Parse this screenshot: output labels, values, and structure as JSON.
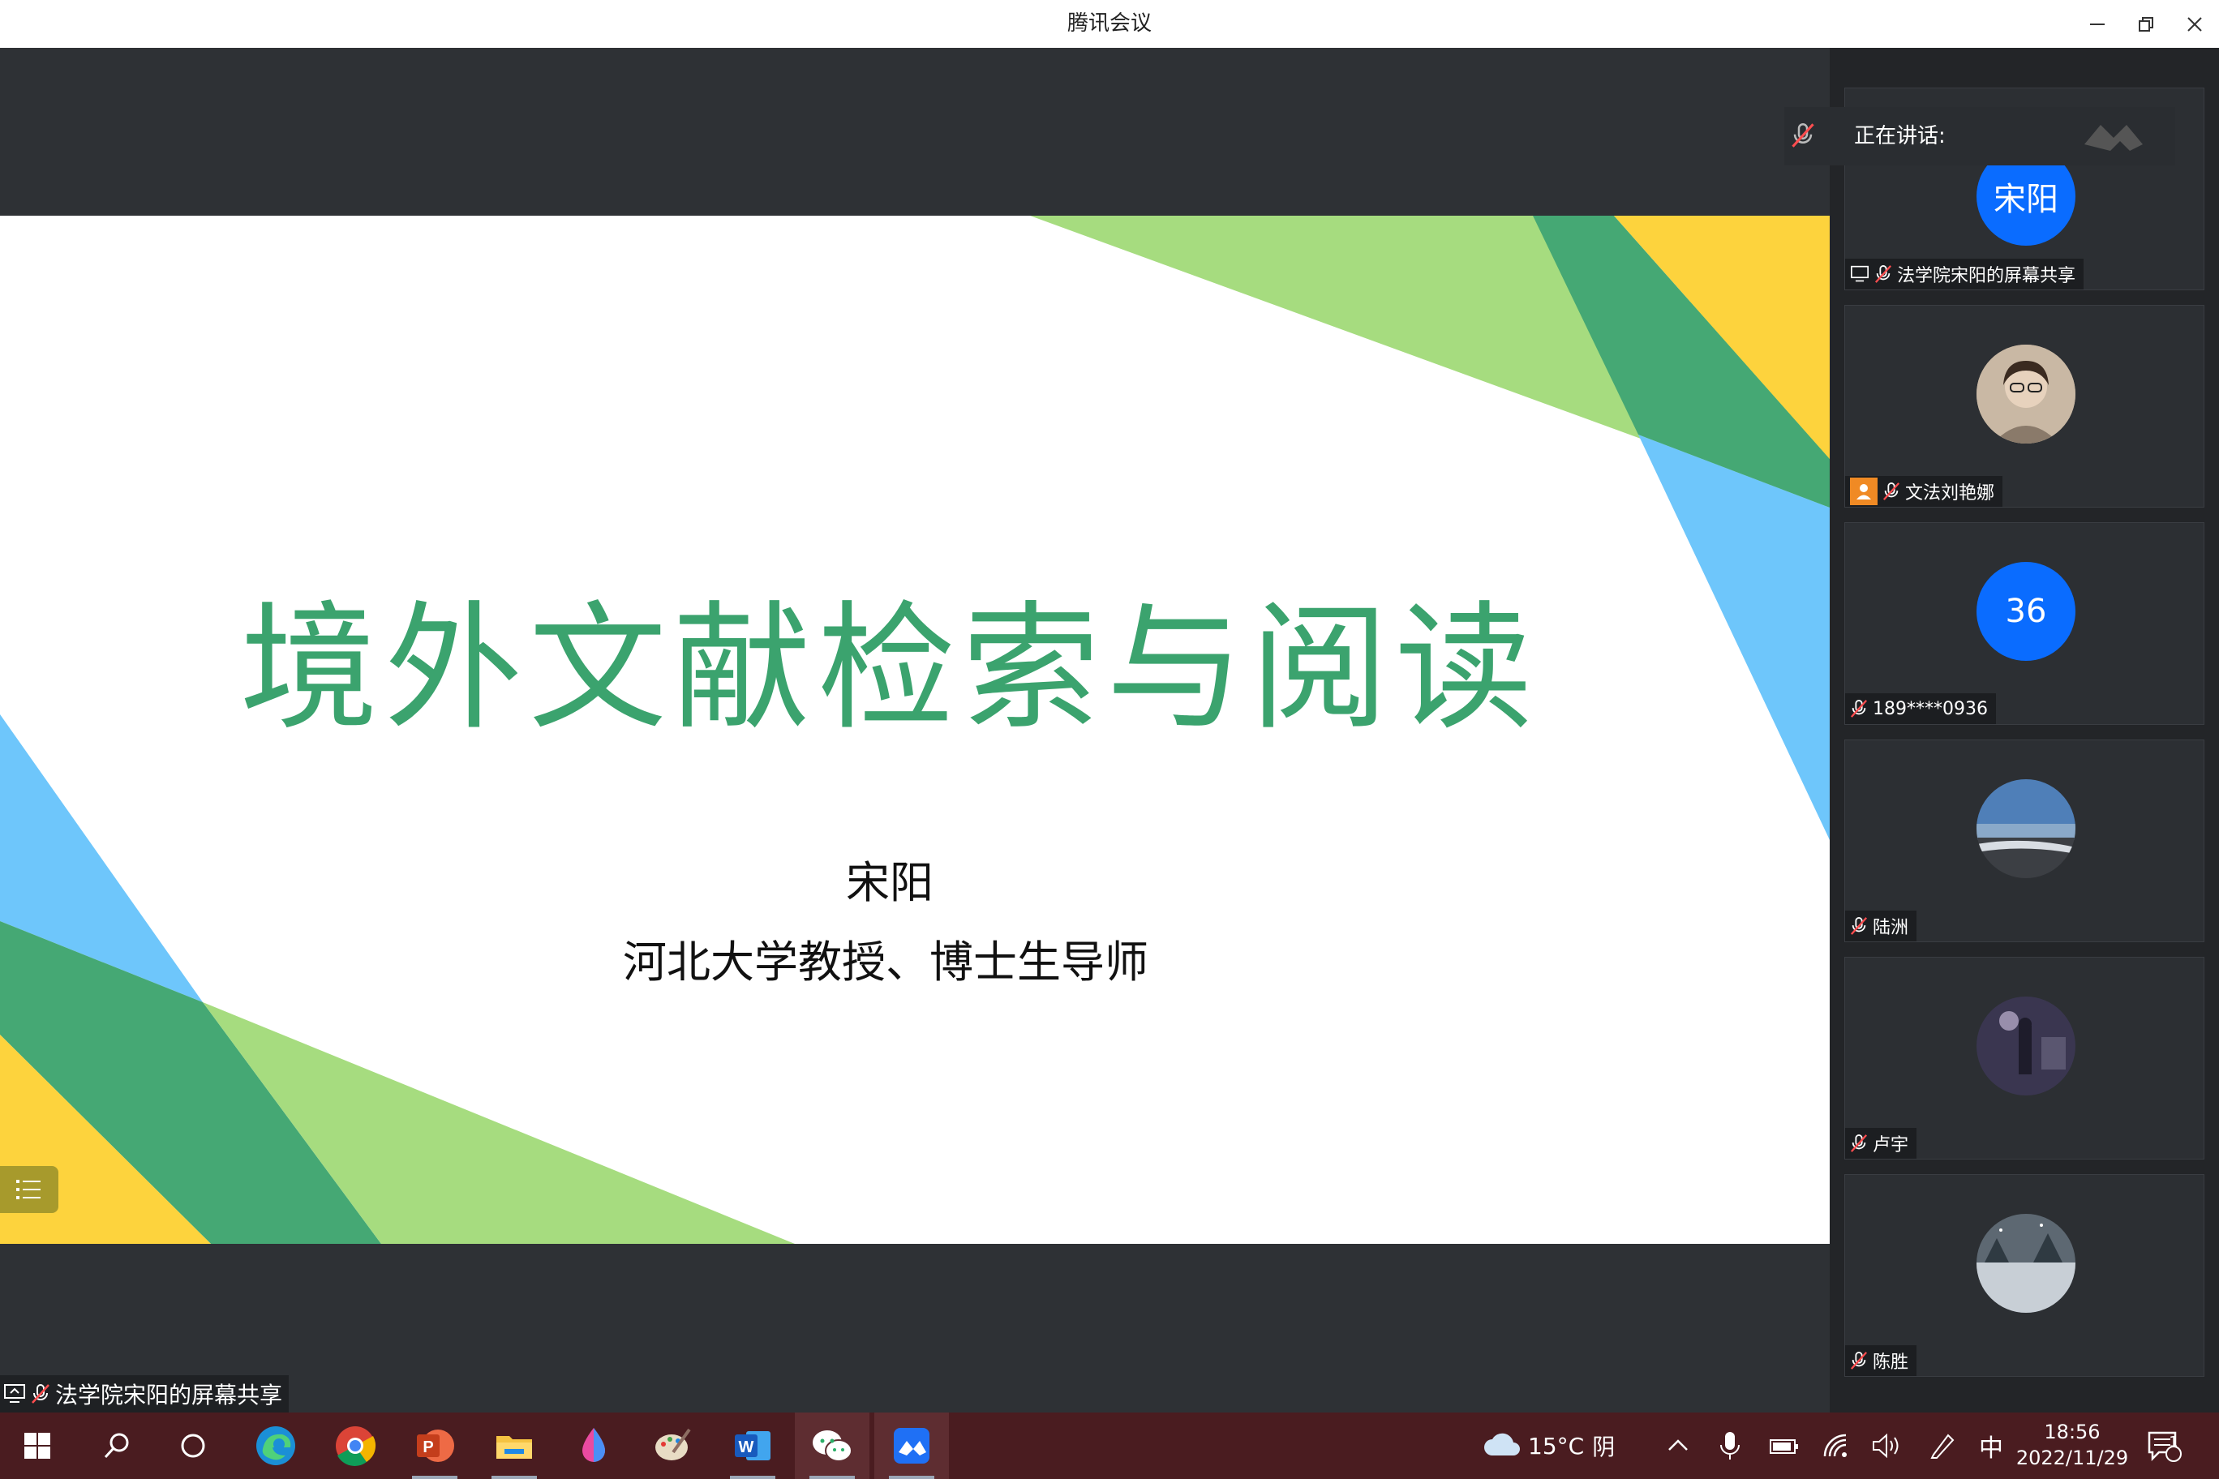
{
  "window": {
    "title": "腾讯会议"
  },
  "slide": {
    "title": "境外文献检索与阅读",
    "presenter": "宋阳",
    "affiliation": "河北大学教授、博士生导师"
  },
  "speaking": {
    "label": "正在讲话:"
  },
  "share": {
    "label": "法学院宋阳的屏幕共享"
  },
  "participants": [
    {
      "name": "法学院宋阳的屏幕共享",
      "avatar_text": "宋阳",
      "avatar_color": "#0a6cff"
    },
    {
      "name": "文法刘艳娜",
      "avatar_text": "",
      "avatar_color": "#b9a792"
    },
    {
      "name": "189****0936",
      "avatar_text": "36",
      "avatar_color": "#0a6cff"
    },
    {
      "name": "陆洲",
      "avatar_text": "",
      "avatar_color": "#6d8fb8"
    },
    {
      "name": "卢宇",
      "avatar_text": "",
      "avatar_color": "#3e3a55"
    },
    {
      "name": "陈胜",
      "avatar_text": "",
      "avatar_color": "#5d6872"
    }
  ],
  "taskbar": {
    "weather_temp": "15°C",
    "weather_desc": "阴",
    "ime": "中",
    "time": "18:56",
    "date": "2022/11/29",
    "notification_count": "1"
  },
  "colors": {
    "accent_green": "#3ba36e",
    "light_green": "#a6dc7f",
    "dark_green": "#45a874",
    "yellow": "#fdd33d",
    "blue": "#6ec6fb",
    "taskbar": "#4a1c20"
  }
}
